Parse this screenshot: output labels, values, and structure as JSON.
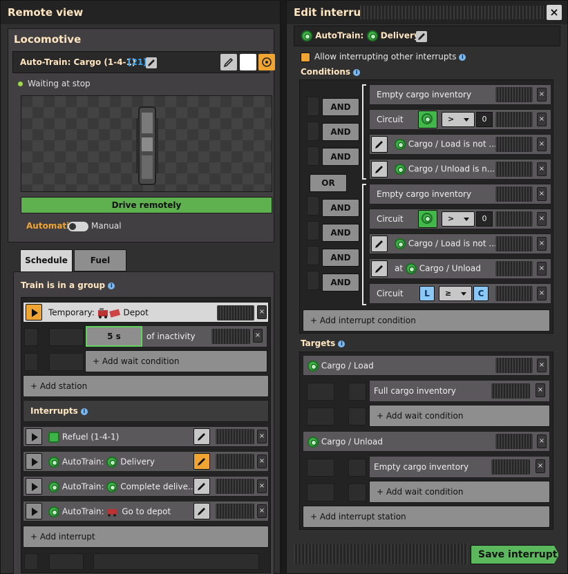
{
  "remote_view": {
    "title": "Remote view",
    "section_title": "Locomotive",
    "train_name": "Auto-Train: Cargo (1-4-1)",
    "train_id": "[21]",
    "status": "Waiting at stop",
    "drive_remotely": "Drive remotely",
    "mode_automatic": "Automatic",
    "mode_manual": "Manual",
    "tabs": [
      "Schedule",
      "Fuel"
    ],
    "group_label": "Train is in a group",
    "temporary_station": "Temporary:",
    "temporary_target": "Depot",
    "wait_value": "5 s",
    "wait_text": "of inactivity",
    "add_wait_condition": "+ Add wait condition",
    "add_station": "+ Add station",
    "interrupts_label": "Interrupts",
    "interrupts": [
      {
        "label": "Refuel (1-4-1)",
        "prefix": ""
      },
      {
        "prefix": "AutoTrain:",
        "label": "Delivery"
      },
      {
        "prefix": "AutoTrain:",
        "label": "Complete delive..."
      },
      {
        "prefix": "AutoTrain:",
        "label": "Go to depot"
      }
    ],
    "add_interrupt": "+ Add interrupt"
  },
  "edit_interrupt": {
    "title": "Edit interrupt",
    "interrupt_prefix": "AutoTrain:",
    "interrupt_name": "Delivery",
    "allow_interrupting": "Allow interrupting other interrupts",
    "conditions_label": "Conditions",
    "and_label": "AND",
    "or_label": "OR",
    "group1": [
      {
        "type": "text",
        "label": "Empty cargo inventory"
      },
      {
        "type": "circuit",
        "label": "Circuit",
        "op": ">",
        "value": "0"
      },
      {
        "type": "edit",
        "label": "Cargo / Load is not ..."
      },
      {
        "type": "edit",
        "label": "Cargo / Unload is n..."
      }
    ],
    "group2": [
      {
        "type": "text",
        "label": "Empty cargo inventory"
      },
      {
        "type": "circuit",
        "label": "Circuit",
        "op": ">",
        "value": "0"
      },
      {
        "type": "edit",
        "label": "Cargo / Load is not ..."
      },
      {
        "type": "edit_at",
        "prefix": "at",
        "label": "Cargo / Unload"
      },
      {
        "type": "circuit_lc",
        "label": "Circuit",
        "left": "L",
        "op": "≥",
        "right": "C"
      }
    ],
    "add_interrupt_condition": "+ Add interrupt condition",
    "targets_label": "Targets",
    "targets": [
      {
        "station": "Cargo / Load",
        "condition": "Full cargo inventory",
        "add_wait": "+ Add wait condition"
      },
      {
        "station": "Cargo / Unload",
        "condition": "Empty cargo inventory",
        "add_wait": "+ Add wait condition"
      }
    ],
    "add_interrupt_station": "+ Add interrupt station",
    "save": "Save interrupt"
  },
  "colors": {
    "accent_orange": "#f0a431",
    "drive_green": "#5fb04f",
    "save_green": "#5cb85c",
    "signal_green": "#3cb247",
    "id_blue": "#3fa7f2"
  }
}
